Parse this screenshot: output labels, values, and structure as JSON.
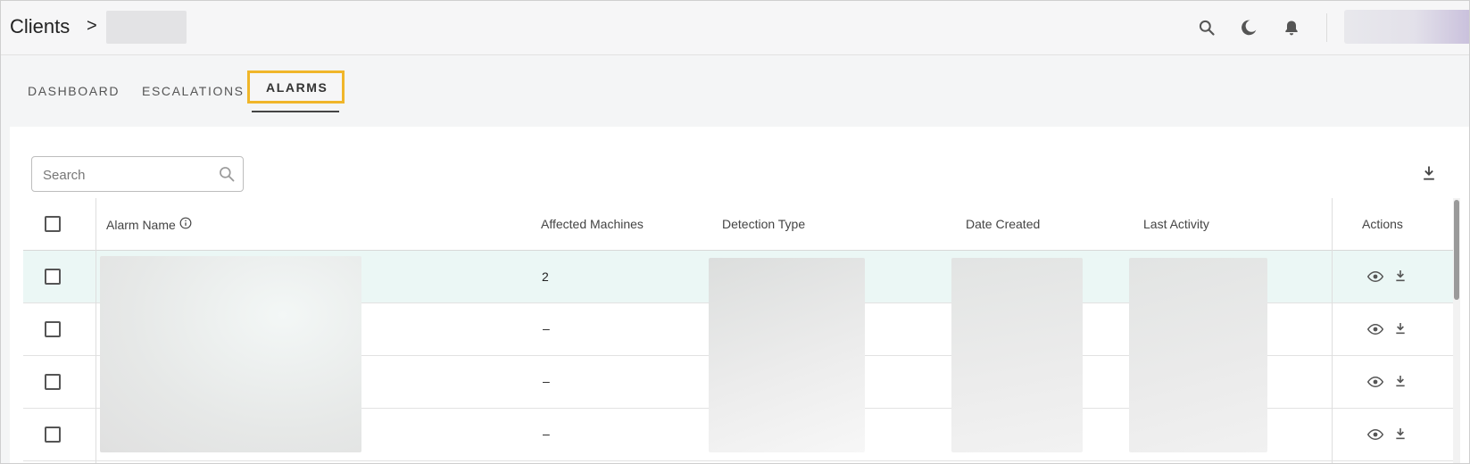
{
  "header": {
    "breadcrumb_root": "Clients",
    "breadcrumb_separator": ">",
    "icons": [
      "search-icon",
      "moon-icon",
      "bell-icon"
    ]
  },
  "tabs": [
    {
      "label": "DASHBOARD",
      "active": false
    },
    {
      "label": "ESCALATIONS",
      "active": false
    },
    {
      "label": "ALARMS",
      "active": true
    }
  ],
  "search": {
    "placeholder": "Search",
    "value": ""
  },
  "table": {
    "columns": [
      "Alarm Name",
      "Affected Machines",
      "Detection Type",
      "Date Created",
      "Last Activity",
      "Actions"
    ],
    "rows": [
      {
        "affected_machines": "2",
        "highlighted": true
      },
      {
        "affected_machines": "–",
        "highlighted": false
      },
      {
        "affected_machines": "–",
        "highlighted": false
      },
      {
        "affected_machines": "–",
        "highlighted": false
      }
    ],
    "row_actions": [
      "eye-icon",
      "download-icon"
    ]
  },
  "colors": {
    "accent_outline": "#f0b62a",
    "highlight_row": "#ebf7f5",
    "icon": "#555555"
  }
}
